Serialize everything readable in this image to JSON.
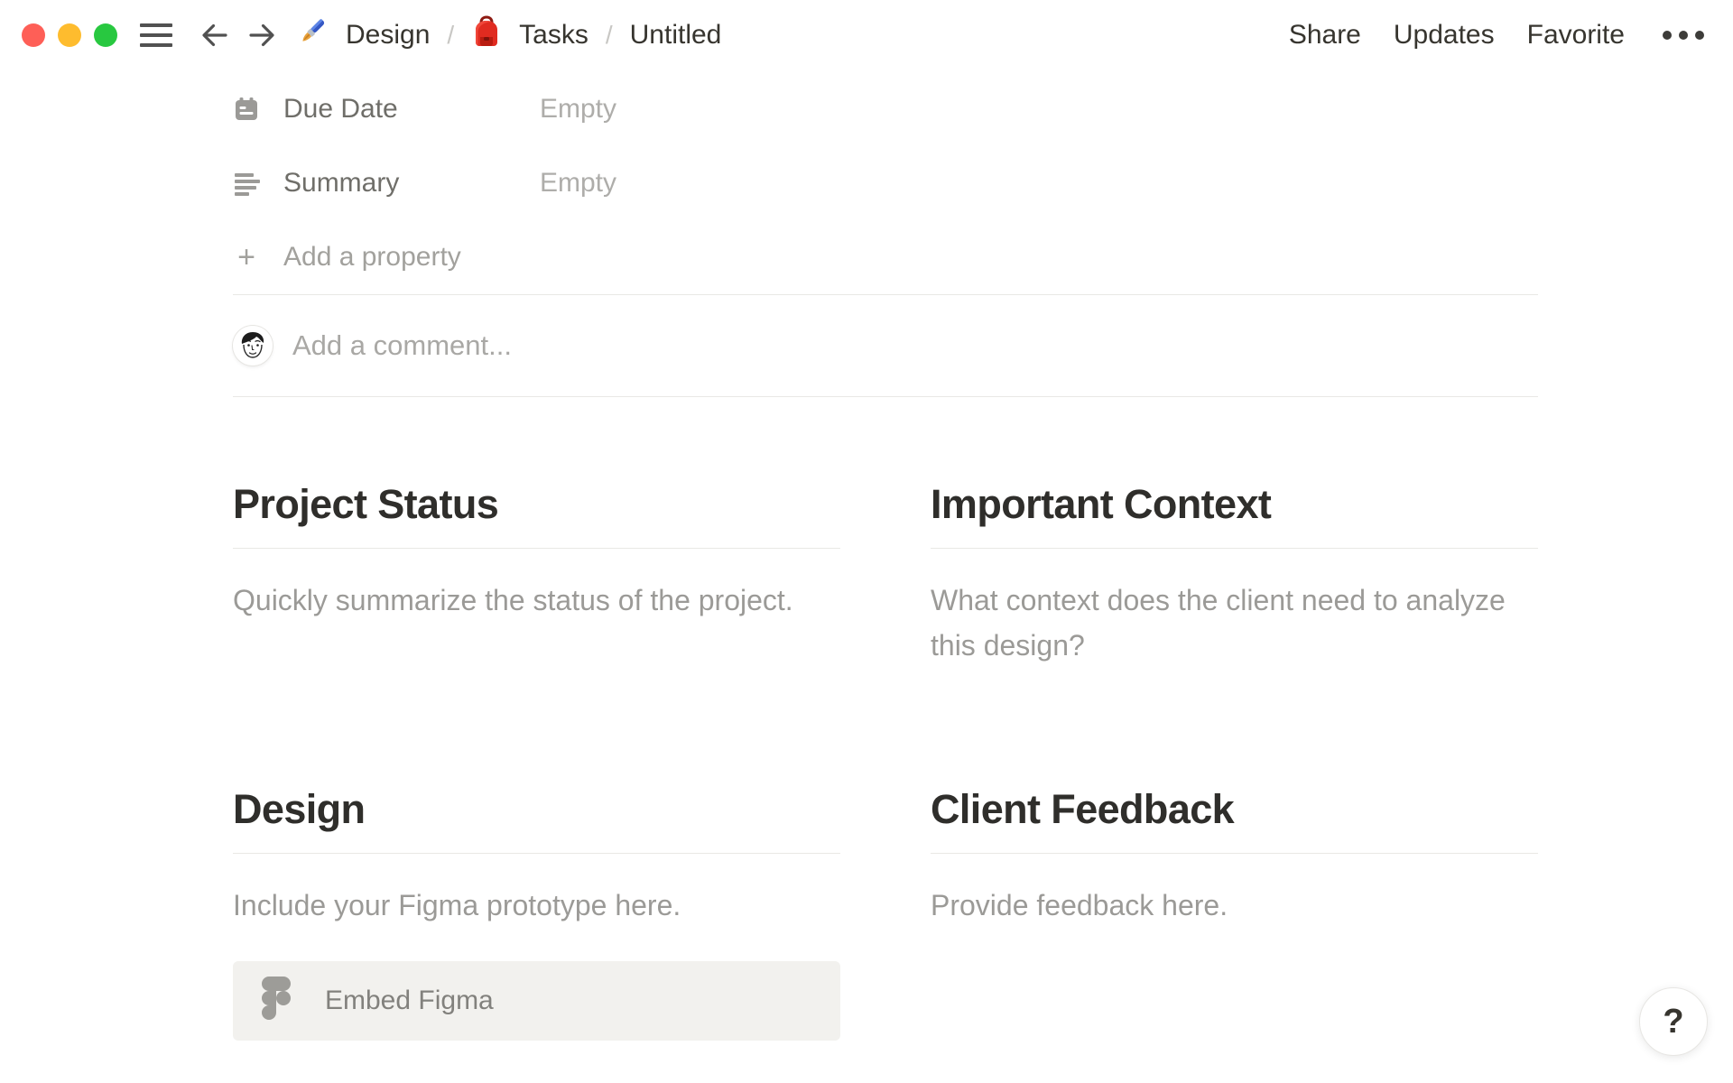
{
  "window": {
    "traffic_lights": [
      "close",
      "minimize",
      "zoom"
    ],
    "traffic_colors": {
      "red": "#fe5f57",
      "yellow": "#febc2e",
      "green": "#28c840"
    }
  },
  "topbar": {
    "separator": "/",
    "breadcrumb": [
      {
        "icon": "paintbrush-emoji",
        "label": "Design"
      },
      {
        "icon": "backpack-emoji",
        "label": "Tasks"
      },
      {
        "label": "Untitled"
      }
    ],
    "actions": {
      "share": "Share",
      "updates": "Updates",
      "favorite": "Favorite"
    },
    "more_icon": "ellipsis-icon"
  },
  "properties": {
    "rows": [
      {
        "icon": "calendar-icon",
        "name": "Due Date",
        "value": "Empty"
      },
      {
        "icon": "text-lines-icon",
        "name": "Summary",
        "value": "Empty"
      }
    ],
    "add_property_label": "Add a property",
    "plus_glyph": "+"
  },
  "comment": {
    "placeholder": "Add a comment..."
  },
  "sections": [
    {
      "title": "Project Status",
      "body": "Quickly summarize the status of the project."
    },
    {
      "title": "Important Context",
      "body": "What context does the client need to analyze this design?"
    },
    {
      "title": "Design",
      "body": "Include your Figma prototype here.",
      "embed": {
        "icon": "figma-logo-icon",
        "label": "Embed Figma"
      }
    },
    {
      "title": "Client Feedback",
      "body": "Provide feedback here."
    }
  ],
  "help": {
    "label": "?"
  },
  "colors": {
    "primary_text": "#37352f",
    "property_label": "#6f6e69",
    "empty_value": "#aeadaa",
    "placeholder": "#a9a8a5",
    "section_body": "#9b9a97",
    "divider": "#e9e8e5",
    "embed_background": "#f2f1ee",
    "embed_text": "#82817d",
    "figma_icon_gray": "#9d9c98"
  }
}
